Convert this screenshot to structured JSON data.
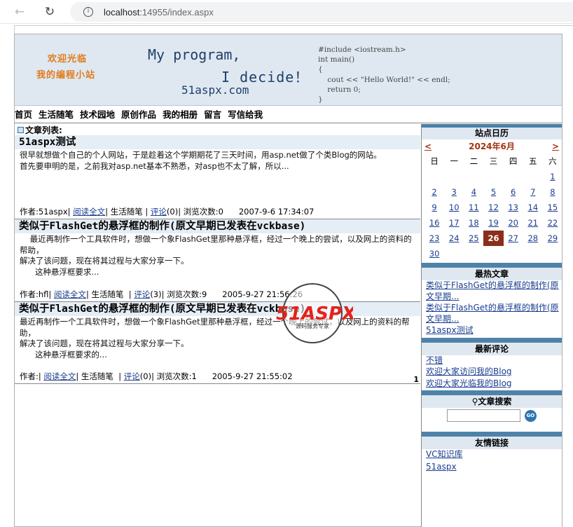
{
  "browser": {
    "url_host": "localhost",
    "url_rest": ":14955/index.aspx"
  },
  "header": {
    "welcome1": "欢迎光临",
    "welcome2": "我的编程小站",
    "slogan1": "My program,",
    "slogan2": "I decide！",
    "site_name": "51aspx.com",
    "code": "#include <iostream.h>\nint main()\n{\n    cout << \"Hello World!\" << endl;\n    return 0;\n}"
  },
  "menu": [
    "首页",
    "生活随笔",
    "技术园地",
    "原创作品",
    "我的相册",
    "留言",
    "写信给我"
  ],
  "main": {
    "list_title": "文章列表:",
    "posts": [
      {
        "title": "51aspx测试",
        "body": "很早就想做个自己的个人网站，于是趁着这个学期期花了三天时间，用asp.net做了个类Blog的网站。\n首先要申明的是，之前我对asp.net基本不熟悉，对asp也不太了解，所以...",
        "author": "作者:51aspx|",
        "read": "阅读全文",
        "category": "| 生活随笔 |",
        "comment": "评论",
        "comment_count": "(0)| 浏览次数:0",
        "date": "2007-9-6 17:34:07"
      },
      {
        "title": "类似于FlashGet的悬浮框的制作(原文早期已发表在vckbase)",
        "body": "    最近再制作一个工具软件时，想做一个象FlashGet里那种悬浮框，经过一个晚上的尝试，以及网上的资料的帮助，\n解决了该问题，现在将其过程与大家分享一下。\n      这种悬浮框要求...",
        "author": "作者:hfl|",
        "read": "阅读全文",
        "category": "| 生活随笔  |",
        "comment": "评论",
        "comment_count": "(3)| 浏览次数:9",
        "date": "2005-9-27 21:56:26"
      },
      {
        "title": "类似于FlashGet的悬浮框的制作(原文早期已发表在vckbase)",
        "body": "最近再制作一个工具软件时，想做一个象FlashGet里那种悬浮框，经过一个晚上的尝试，以及网上的资料的帮助，\n解决了该问题，现在将其过程与大家分享一下。\n      这种悬浮框要求的...",
        "author": "作者:|",
        "read": "阅读全文",
        "category": "| 生活随笔  |",
        "comment": "评论",
        "comment_count": "(0)| 浏览次数:1",
        "date": "2005-9-27 21:55:02"
      }
    ],
    "pager": "1"
  },
  "sidebar": {
    "calendar_title": "站点日历",
    "prev": "<",
    "next": ">",
    "month": "2024年6月",
    "weekdays": [
      "日",
      "一",
      "二",
      "三",
      "四",
      "五",
      "六"
    ],
    "weeks": [
      [
        "",
        "",
        "",
        "",
        "",
        "",
        "1"
      ],
      [
        "2",
        "3",
        "4",
        "5",
        "6",
        "7",
        "8"
      ],
      [
        "9",
        "10",
        "11",
        "12",
        "13",
        "14",
        "15"
      ],
      [
        "16",
        "17",
        "18",
        "19",
        "20",
        "21",
        "22"
      ],
      [
        "23",
        "24",
        "25",
        "26",
        "27",
        "28",
        "29"
      ],
      [
        "30",
        "",
        "",
        "",
        "",
        "",
        ""
      ]
    ],
    "today": "26",
    "hot_title": "最热文章",
    "hot": [
      "类似于FlashGet的悬浮框的制作(原文早期...",
      "类似于FlashGet的悬浮框的制作(原文早期...",
      "51aspx测试"
    ],
    "comments_title": "最新评论",
    "comments": [
      "不错",
      "欢迎大家访问我的Blog",
      "欢迎大家光临我的Blog"
    ],
    "search_title": "文章搜索",
    "search_go": "GO",
    "links_title": "友情链接",
    "links": [
      "VC知识库",
      "51aspx"
    ]
  },
  "watermark": {
    "brand": "51ASPX",
    "sub": "源码服务专家"
  }
}
